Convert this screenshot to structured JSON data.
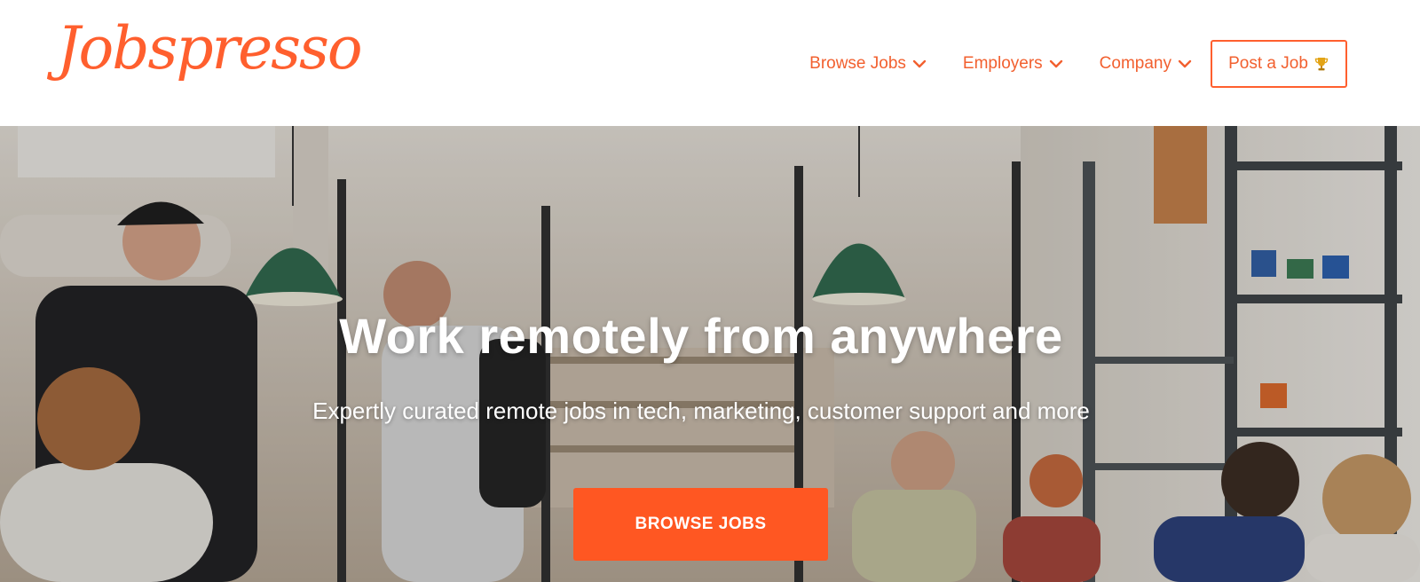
{
  "brand": {
    "logo_text": "Jobspresso",
    "accent_color": "#ff5f2e"
  },
  "nav": {
    "items": [
      {
        "label": "Browse Jobs",
        "icon": "chevron-down-icon"
      },
      {
        "label": "Employers",
        "icon": "chevron-down-icon"
      },
      {
        "label": "Company",
        "icon": "chevron-down-icon"
      }
    ],
    "post_job": {
      "label": "Post a Job",
      "icon": "trophy-icon"
    }
  },
  "hero": {
    "headline": "Work remotely from anywhere",
    "subheadline": "Expertly curated remote jobs in tech, marketing, customer support and more",
    "cta_label": "BROWSE JOBS",
    "cta_color": "#ff5722",
    "background": "coworking-cafe-photo"
  }
}
